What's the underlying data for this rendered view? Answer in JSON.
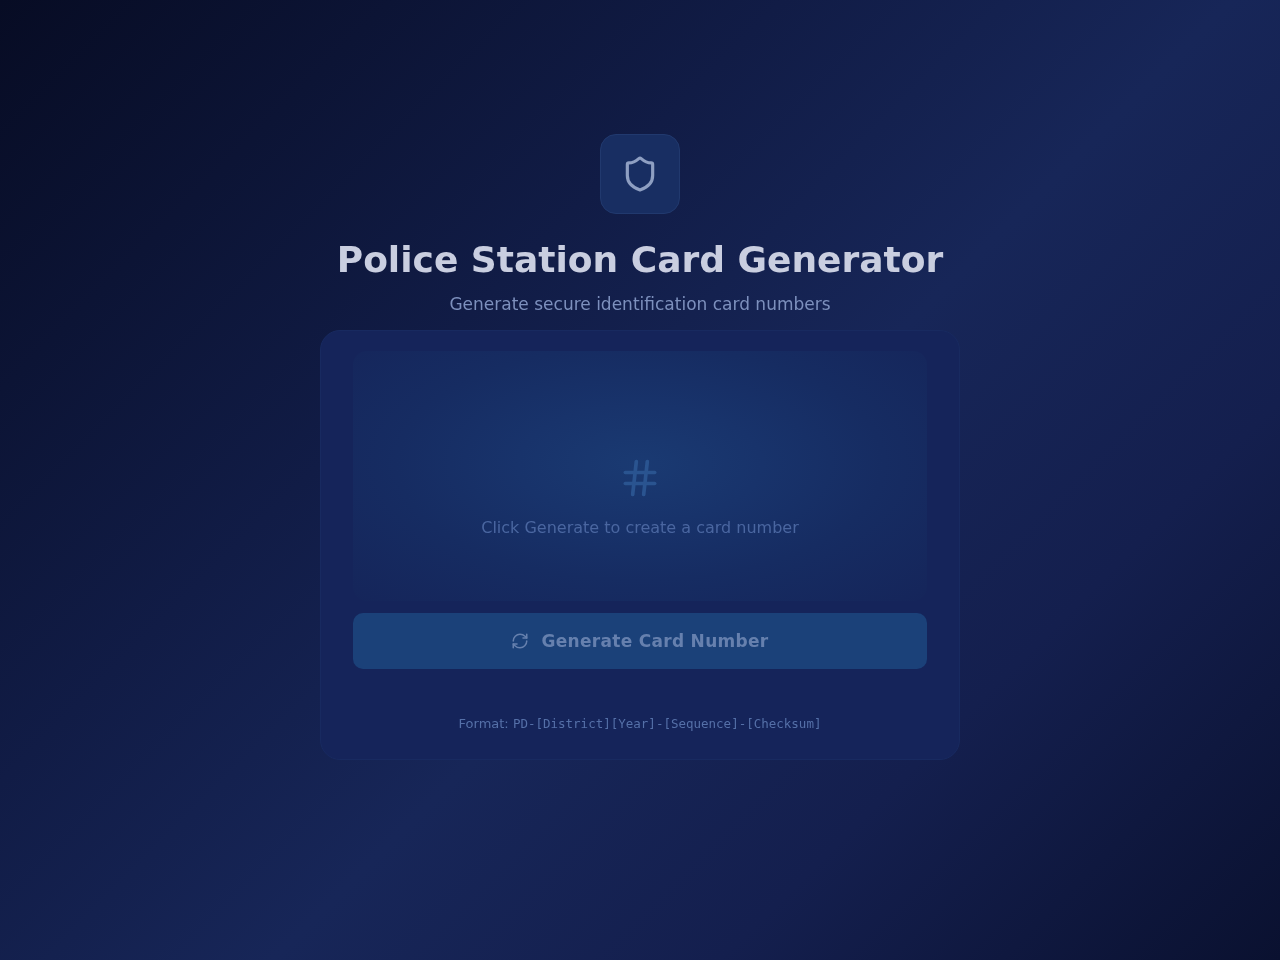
{
  "header": {
    "title": "Police Station Card Generator",
    "subtitle": "Generate secure identification card numbers"
  },
  "card": {
    "display": {
      "empty_message": "Click Generate to create a card number"
    },
    "generate_button": {
      "label": "Generate Card Number"
    },
    "format": {
      "label": "Format:",
      "pattern": "PD-[District][Year]-[Sequence]-[Checksum]"
    }
  }
}
